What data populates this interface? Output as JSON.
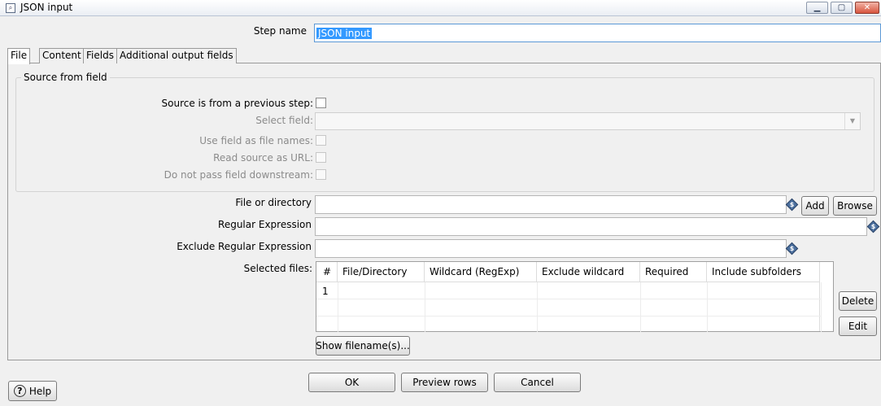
{
  "window": {
    "title": "JSON input",
    "minimize_icon": "minimize-icon",
    "maximize_icon": "maximize-icon",
    "close_icon": "close-icon"
  },
  "step_name": {
    "label": "Step name",
    "value": "JSON input"
  },
  "tabs": [
    {
      "label": "File",
      "active": true
    },
    {
      "label": "Content",
      "active": false
    },
    {
      "label": "Fields",
      "active": false
    },
    {
      "label": "Additional output fields",
      "active": false
    }
  ],
  "source_from_field": {
    "title": "Source from field",
    "source_is_from_previous_step": "Source is from a previous step:",
    "select_field": "Select field:",
    "use_field_as_file_names": "Use field as file names:",
    "read_source_as_url": "Read source as URL:",
    "do_not_pass_field_downstream": "Do not pass field downstream:"
  },
  "file_section": {
    "file_or_directory_label": "File or directory",
    "add_button": "Add",
    "browse_button": "Browse",
    "regular_expression_label": "Regular Expression",
    "exclude_regular_expression_label": "Exclude Regular Expression",
    "selected_files_label": "Selected files:",
    "delete_button": "Delete",
    "edit_button": "Edit",
    "show_filenames_button": "Show filename(s)..."
  },
  "selected_files_table": {
    "columns": [
      "#",
      "File/Directory",
      "Wildcard (RegExp)",
      "Exclude wildcard",
      "Required",
      "Include subfolders"
    ],
    "rows": [
      [
        "1",
        "",
        "",
        "",
        "",
        ""
      ]
    ]
  },
  "footer": {
    "ok_button": "OK",
    "preview_button": "Preview rows",
    "cancel_button": "Cancel",
    "help_button": "Help"
  },
  "colors": {
    "selection": "#3399ff",
    "background": "#f0f0f0"
  }
}
